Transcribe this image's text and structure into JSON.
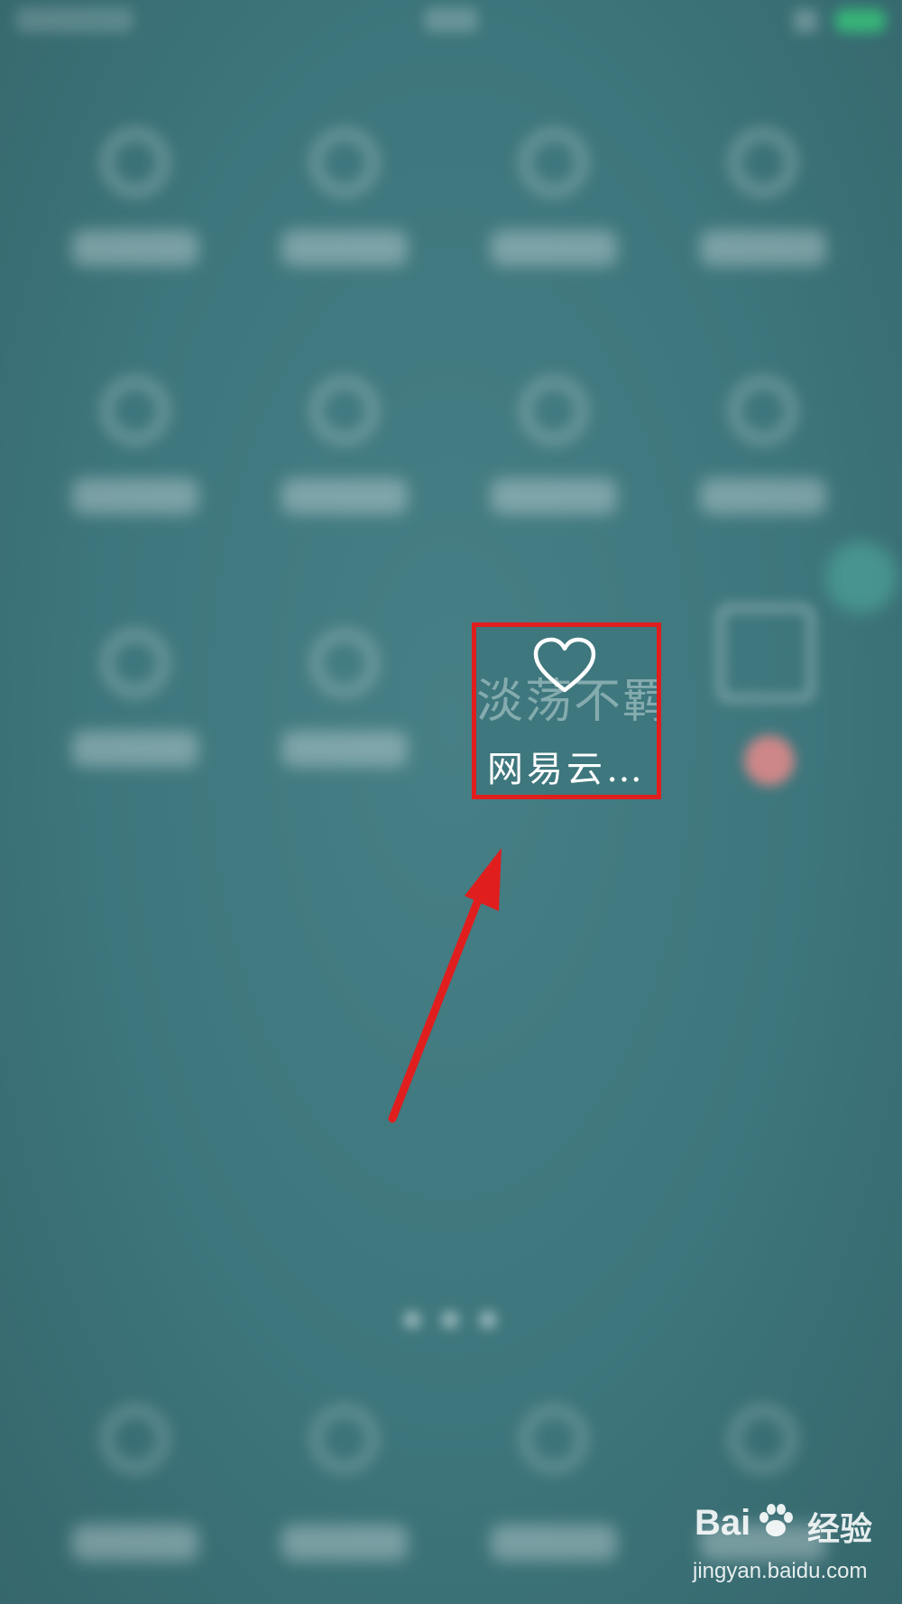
{
  "widget": {
    "background_text": "淡荡不羁",
    "name": "网易云…",
    "highlight_color": "#e01e1e",
    "icon": "heart-icon"
  },
  "annotation": {
    "arrow_color": "#e01e1e",
    "arrow_icon": "arrow-icon"
  },
  "watermark": {
    "brand": "Bai",
    "brand_cn": "经验",
    "url": "jingyan.baidu.com",
    "logo_icon": "baidu-paw-icon"
  },
  "colors": {
    "wallpaper": "#3f7a80",
    "battery": "#37c77a"
  }
}
